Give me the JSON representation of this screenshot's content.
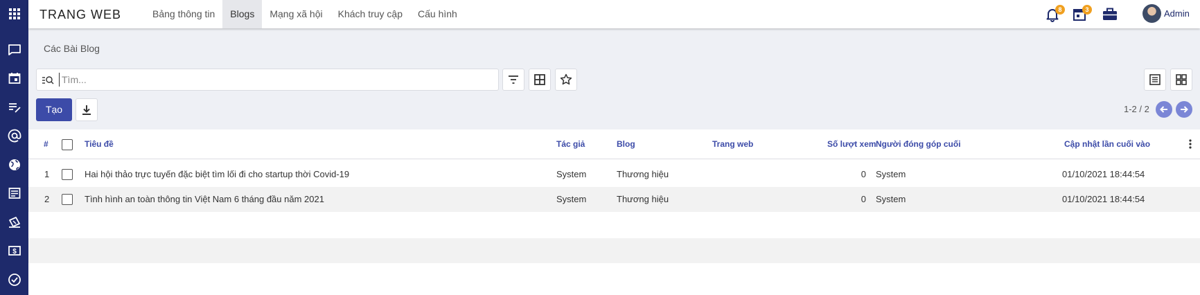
{
  "app": {
    "brand": "TRANG WEB"
  },
  "nav": {
    "items": [
      {
        "label": "Bảng thông tin"
      },
      {
        "label": "Blogs"
      },
      {
        "label": "Mạng xã hội"
      },
      {
        "label": "Khách truy cập"
      },
      {
        "label": "Cấu hình"
      }
    ],
    "active": "Blogs"
  },
  "topbar": {
    "notifications_count": "8",
    "activities_count": "3",
    "user_name": "Admin"
  },
  "sidebar": {
    "icons": [
      "apps-icon",
      "chat-icon",
      "calendar-icon",
      "notes-icon",
      "at-icon",
      "globe-icon",
      "newspaper-icon",
      "ticket-icon",
      "money-icon",
      "check-circle-icon"
    ]
  },
  "breadcrumb": "Các Bài Blog",
  "search": {
    "placeholder": "Tìm...",
    "value": ""
  },
  "toolbar": {
    "create_label": "Tạo"
  },
  "pager": {
    "text": "1-2 / 2"
  },
  "table": {
    "headers": {
      "num": "#",
      "title": "Tiêu đề",
      "author": "Tác giả",
      "blog": "Blog",
      "website": "Trang web",
      "views": "Số lượt xem",
      "last_contributor": "Người đóng góp cuối",
      "updated": "Cập nhật lần cuối vào"
    },
    "rows": [
      {
        "num": "1",
        "title": "Hai hội thảo trực tuyến đặc biệt tìm lối đi cho startup thời Covid-19",
        "author": "System",
        "blog": "Thương hiệu",
        "website": "",
        "views": "0",
        "last_contributor": "System",
        "updated": "01/10/2021 18:44:54"
      },
      {
        "num": "2",
        "title": "Tình hình an toàn thông tin Việt Nam 6 tháng đầu năm 2021",
        "author": "System",
        "blog": "Thương hiệu",
        "website": "",
        "views": "0",
        "last_contributor": "System",
        "updated": "01/10/2021 18:44:54"
      }
    ]
  },
  "colors": {
    "sidebar": "#1e2a6b",
    "accent": "#3c4ba8",
    "badge": "#f0a020",
    "pager_button": "#7b86d6"
  }
}
